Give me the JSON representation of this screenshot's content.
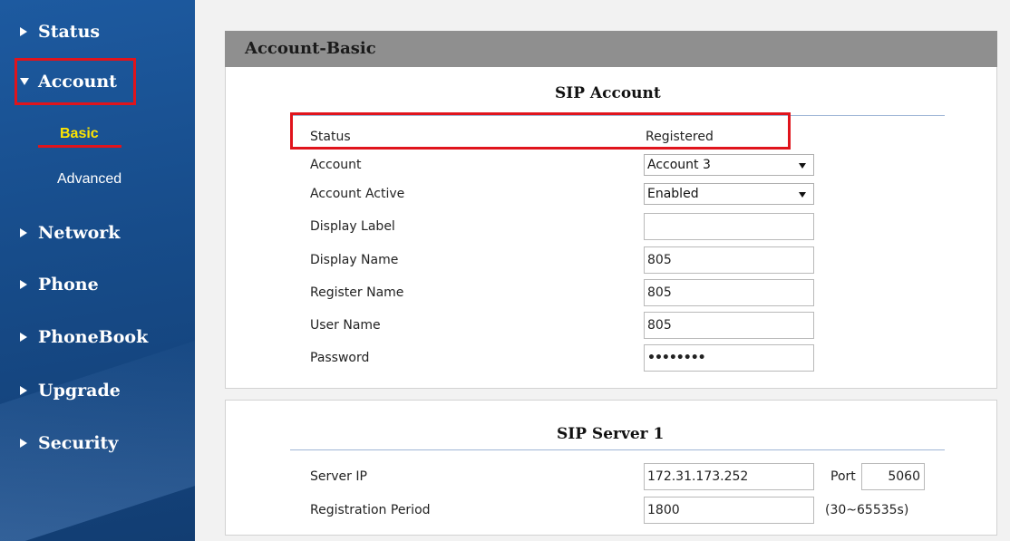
{
  "sidebar": {
    "items": [
      {
        "label": "Status"
      },
      {
        "label": "Account"
      },
      {
        "label": "Network"
      },
      {
        "label": "Phone"
      },
      {
        "label": "PhoneBook"
      },
      {
        "label": "Upgrade"
      },
      {
        "label": "Security"
      }
    ],
    "account_sub": [
      {
        "label": "Basic",
        "selected": true
      },
      {
        "label": "Advanced"
      }
    ]
  },
  "page": {
    "title": "Account-Basic"
  },
  "sip_account": {
    "title": "SIP Account",
    "status_label": "Status",
    "status_value": "Registered",
    "account_label": "Account",
    "account_value": "Account 3",
    "account_active_label": "Account Active",
    "account_active_value": "Enabled",
    "display_label_label": "Display Label",
    "display_label_value": "",
    "display_name_label": "Display Name",
    "display_name_value": "805",
    "register_name_label": "Register Name",
    "register_name_value": "805",
    "user_name_label": "User Name",
    "user_name_value": "805",
    "password_label": "Password",
    "password_value": "••••••••"
  },
  "sip_server_1": {
    "title": "SIP Server 1",
    "server_ip_label": "Server IP",
    "server_ip_value": "172.31.173.252",
    "port_label": "Port",
    "port_value": "5060",
    "registration_period_label": "Registration Period",
    "registration_period_value": "1800",
    "registration_period_hint": "(30~65535s)"
  },
  "colors": {
    "sidebar": "#1a5396",
    "highlight": "#e0141c",
    "selected_text": "#ffe600",
    "panel_header": "#8f8f8f"
  }
}
